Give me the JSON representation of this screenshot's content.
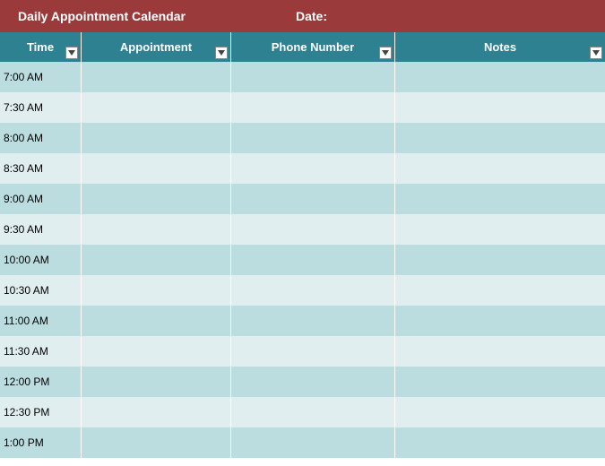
{
  "titlebar": {
    "label": "Daily Appointment Calendar",
    "date_label": "Date:"
  },
  "columns": [
    {
      "key": "time",
      "label": "Time"
    },
    {
      "key": "appointment",
      "label": "Appointment"
    },
    {
      "key": "phone",
      "label": "Phone Number"
    },
    {
      "key": "notes",
      "label": "Notes"
    }
  ],
  "rows": [
    {
      "time": "7:00 AM",
      "appointment": "",
      "phone": "",
      "notes": ""
    },
    {
      "time": "7:30 AM",
      "appointment": "",
      "phone": "",
      "notes": ""
    },
    {
      "time": "8:00 AM",
      "appointment": "",
      "phone": "",
      "notes": ""
    },
    {
      "time": "8:30 AM",
      "appointment": "",
      "phone": "",
      "notes": ""
    },
    {
      "time": "9:00 AM",
      "appointment": "",
      "phone": "",
      "notes": ""
    },
    {
      "time": "9:30 AM",
      "appointment": "",
      "phone": "",
      "notes": ""
    },
    {
      "time": "10:00 AM",
      "appointment": "",
      "phone": "",
      "notes": ""
    },
    {
      "time": "10:30 AM",
      "appointment": "",
      "phone": "",
      "notes": ""
    },
    {
      "time": "11:00 AM",
      "appointment": "",
      "phone": "",
      "notes": ""
    },
    {
      "time": "11:30 AM",
      "appointment": "",
      "phone": "",
      "notes": ""
    },
    {
      "time": "12:00 PM",
      "appointment": "",
      "phone": "",
      "notes": ""
    },
    {
      "time": "12:30 PM",
      "appointment": "",
      "phone": "",
      "notes": ""
    },
    {
      "time": "1:00 PM",
      "appointment": "",
      "phone": "",
      "notes": ""
    }
  ]
}
